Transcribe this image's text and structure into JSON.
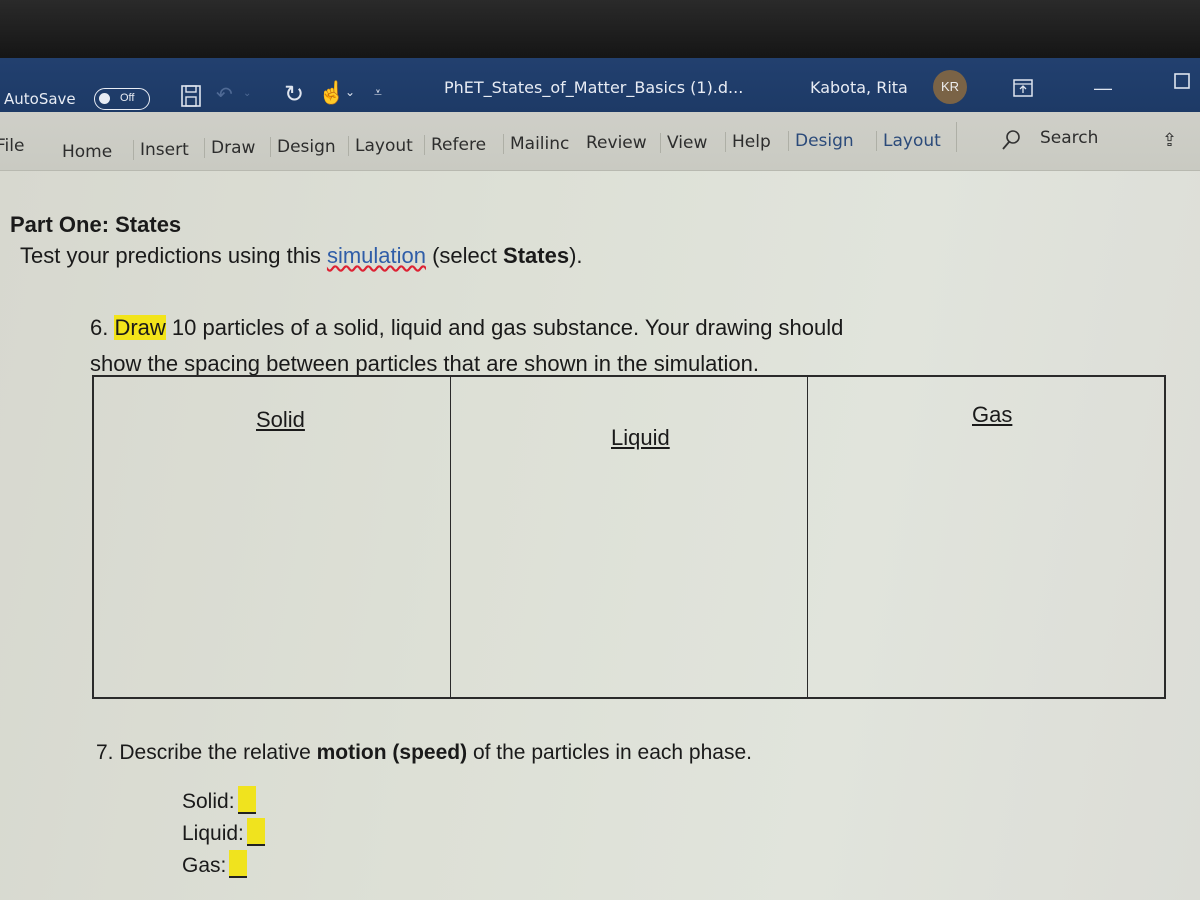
{
  "titlebar": {
    "autosave_label": "AutoSave",
    "autosave_state": "Off",
    "document_title": "PhET_States_of_Matter_Basics (1).d...",
    "user_name": "Kabota, Rita",
    "user_initials": "KR",
    "icons": [
      "save-icon",
      "undo-icon",
      "redo-icon",
      "touch-mode-icon",
      "customize-toolbar-icon",
      "ribbon-display-icon",
      "minimize-icon",
      "maximize-icon"
    ]
  },
  "ribbon": {
    "tabs": [
      {
        "label": "File"
      },
      {
        "label": "Home"
      },
      {
        "label": "Insert"
      },
      {
        "label": "Draw"
      },
      {
        "label": "Design"
      },
      {
        "label": "Layout"
      },
      {
        "label": "Refere"
      },
      {
        "label": "Mailinc"
      },
      {
        "label": "Review"
      },
      {
        "label": "View"
      },
      {
        "label": "Help"
      },
      {
        "label": "Design"
      },
      {
        "label": "Layout"
      }
    ],
    "search_label": "Search"
  },
  "document": {
    "heading": "Part One: States",
    "intro_prefix": "Test your predictions using this ",
    "intro_link": "simulation",
    "intro_mid": " (select ",
    "intro_bold": "States",
    "intro_suffix": ").",
    "q6_number": "6. ",
    "q6_highlight": "Draw",
    "q6_line1": " 10 particles of a solid, liquid and gas substance. Your drawing should",
    "q6_line2": "show the spacing between particles that are shown in the simulation.",
    "table_headers": [
      "Solid",
      "Liquid",
      "Gas"
    ],
    "q7_prefix": "7. Describe the relative ",
    "q7_bold": "motion (speed)",
    "q7_suffix": "  of the particles in each phase.",
    "answers": [
      {
        "label": "Solid:"
      },
      {
        "label": "Liquid:"
      },
      {
        "label": "Gas:"
      }
    ]
  }
}
